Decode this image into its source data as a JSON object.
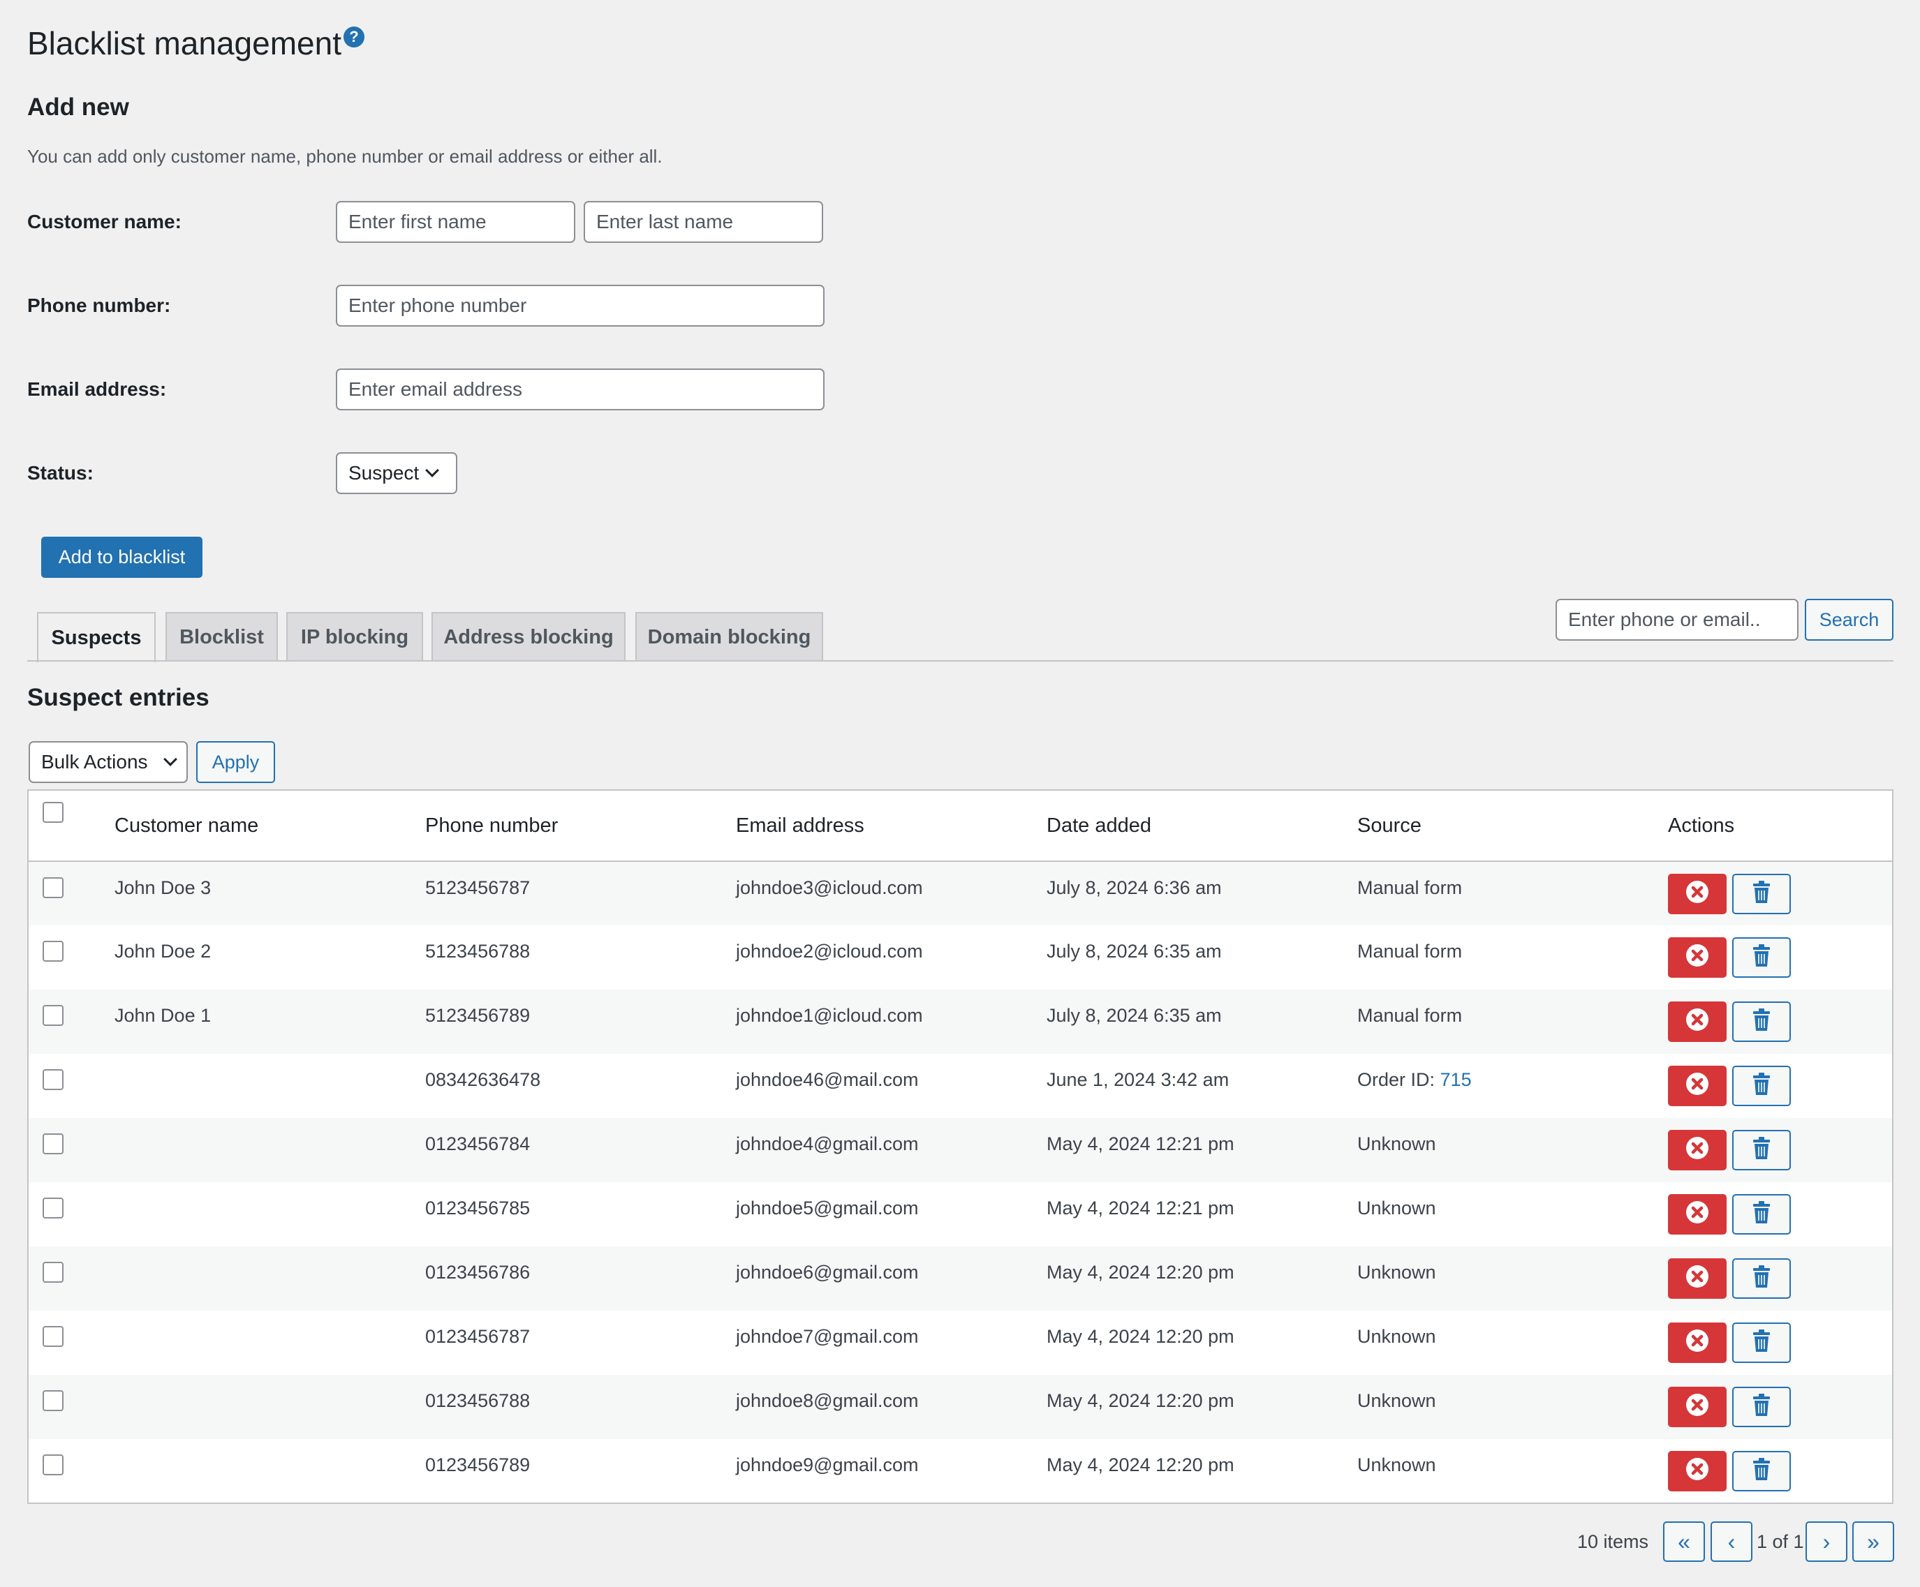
{
  "page": {
    "title": "Blacklist management",
    "help_icon": "?"
  },
  "add_new": {
    "heading": "Add new",
    "description": "You can add only customer name, phone number or email address or either all.",
    "customer_name_label": "Customer name:",
    "first_name_placeholder": "Enter first name",
    "last_name_placeholder": "Enter last name",
    "phone_label": "Phone number:",
    "phone_placeholder": "Enter phone number",
    "email_label": "Email address:",
    "email_placeholder": "Enter email address",
    "status_label": "Status:",
    "status_value": "Suspect",
    "submit_label": "Add to blacklist"
  },
  "tabs": [
    {
      "label": "Suspects",
      "active": true
    },
    {
      "label": "Blocklist",
      "active": false
    },
    {
      "label": "IP blocking",
      "active": false
    },
    {
      "label": "Address blocking",
      "active": false
    },
    {
      "label": "Domain blocking",
      "active": false
    }
  ],
  "search": {
    "placeholder": "Enter phone or email..",
    "button_label": "Search"
  },
  "entries": {
    "heading": "Suspect entries",
    "bulk_actions_label": "Bulk Actions",
    "apply_label": "Apply",
    "columns": [
      "Customer name",
      "Phone number",
      "Email address",
      "Date added",
      "Source",
      "Actions"
    ],
    "rows": [
      {
        "name": "John Doe 3",
        "phone": "5123456787",
        "email": "johndoe3@icloud.com",
        "date": "July 8, 2024 6:36 am",
        "source": "Manual form",
        "source_link": ""
      },
      {
        "name": "John Doe 2",
        "phone": "5123456788",
        "email": "johndoe2@icloud.com",
        "date": "July 8, 2024 6:35 am",
        "source": "Manual form",
        "source_link": ""
      },
      {
        "name": "John Doe 1",
        "phone": "5123456789",
        "email": "johndoe1@icloud.com",
        "date": "July 8, 2024 6:35 am",
        "source": "Manual form",
        "source_link": ""
      },
      {
        "name": "",
        "phone": "08342636478",
        "email": "johndoe46@mail.com",
        "date": "June 1, 2024 3:42 am",
        "source": "Order ID: ",
        "source_link": "715"
      },
      {
        "name": "",
        "phone": "0123456784",
        "email": "johndoe4@gmail.com",
        "date": "May 4, 2024 12:21 pm",
        "source": "Unknown",
        "source_link": ""
      },
      {
        "name": "",
        "phone": "0123456785",
        "email": "johndoe5@gmail.com",
        "date": "May 4, 2024 12:21 pm",
        "source": "Unknown",
        "source_link": ""
      },
      {
        "name": "",
        "phone": "0123456786",
        "email": "johndoe6@gmail.com",
        "date": "May 4, 2024 12:20 pm",
        "source": "Unknown",
        "source_link": ""
      },
      {
        "name": "",
        "phone": "0123456787",
        "email": "johndoe7@gmail.com",
        "date": "May 4, 2024 12:20 pm",
        "source": "Unknown",
        "source_link": ""
      },
      {
        "name": "",
        "phone": "0123456788",
        "email": "johndoe8@gmail.com",
        "date": "May 4, 2024 12:20 pm",
        "source": "Unknown",
        "source_link": ""
      },
      {
        "name": "",
        "phone": "0123456789",
        "email": "johndoe9@gmail.com",
        "date": "May 4, 2024 12:20 pm",
        "source": "Unknown",
        "source_link": ""
      }
    ],
    "row_action_icons": [
      "close-circle-icon",
      "trash-icon"
    ]
  },
  "pagination": {
    "items_count": "10 items",
    "first": "«",
    "prev": "‹",
    "page_info": "1 of 1",
    "next": "›",
    "last": "»"
  },
  "colors": {
    "primary": "#2271b1",
    "danger": "#d63638",
    "background": "#f0f0f1"
  }
}
